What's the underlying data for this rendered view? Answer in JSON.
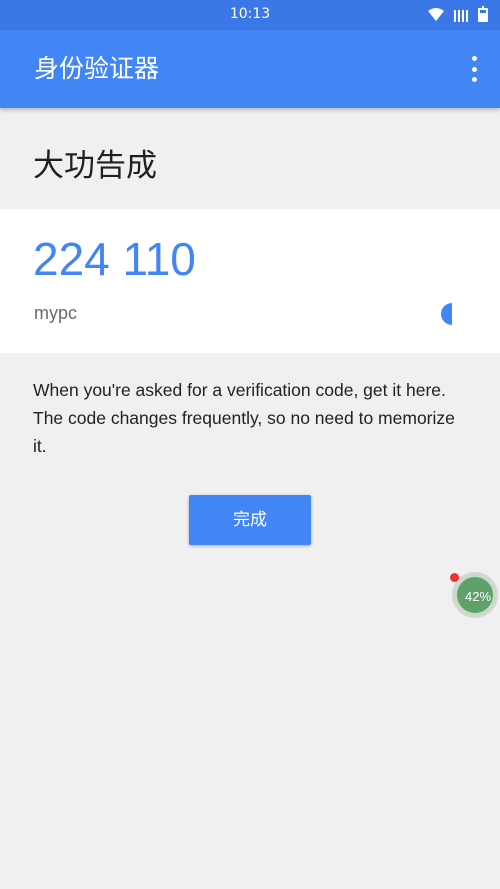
{
  "status_bar": {
    "time": "10:13",
    "icons": [
      "wifi-icon",
      "signal-icon",
      "battery-icon"
    ],
    "color": "#3b78e7"
  },
  "app_bar": {
    "title": "身份验证器",
    "menu_icon": "more-vertical-icon",
    "color": "#4285f4"
  },
  "main": {
    "success_title": "大功告成",
    "code": "224 110",
    "account": "mypc",
    "countdown_icon": "countdown-timer-icon",
    "description": "When you're asked for a verification code, get it here. The code changes frequently, so no need to memorize it.",
    "done_label": "完成"
  },
  "floating_widget": {
    "label": "42%",
    "icon": "memory-ball-icon",
    "badge_color": "#ee3030"
  },
  "colors": {
    "accent": "#4285f4",
    "background": "#f0f0f0"
  }
}
